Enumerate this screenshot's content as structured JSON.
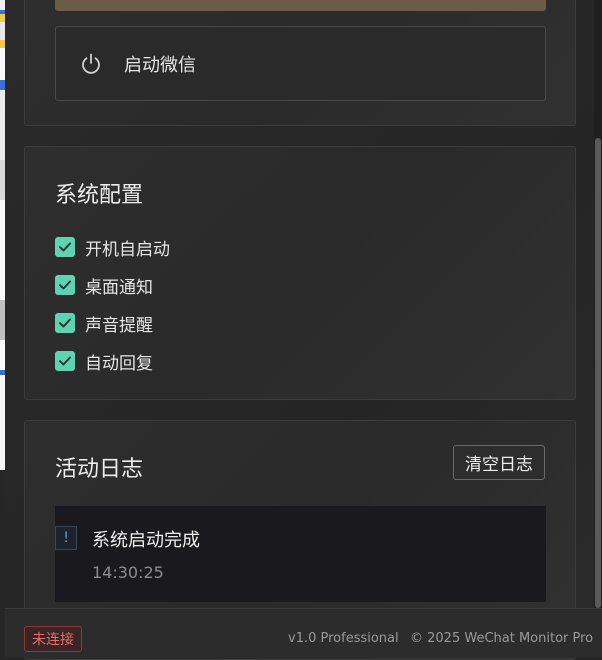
{
  "launch": {
    "label": "启动微信",
    "icon": "power-icon"
  },
  "config": {
    "title": "系统配置",
    "options": [
      {
        "label": "开机自启动",
        "checked": true
      },
      {
        "label": "桌面通知",
        "checked": true
      },
      {
        "label": "声音提醒",
        "checked": true
      },
      {
        "label": "自动回复",
        "checked": true
      }
    ]
  },
  "log": {
    "title": "活动日志",
    "clear_label": "清空日志",
    "entries": [
      {
        "badge": "!",
        "message": "系统启动完成",
        "time": "14:30:25"
      }
    ]
  },
  "status": {
    "connection": "未连接",
    "version": "v1.0 Professional",
    "copyright": "© 2025 WeChat Monitor Pro"
  },
  "colors": {
    "accent": "#5fd3b0",
    "error": "#e07070",
    "info": "#5aa0e0"
  }
}
